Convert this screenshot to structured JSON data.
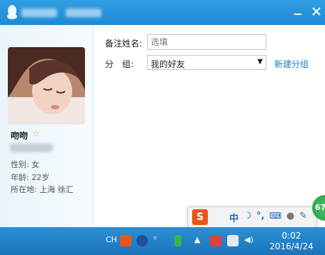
{
  "contact": {
    "nickname": "吻吻",
    "gender": "性别: 女",
    "age": "年龄: 22岁",
    "location": "所在地: 上海  徐汇"
  },
  "form": {
    "remark_label": "备注姓名:",
    "remark_placeholder": "选填",
    "group_label": "分　组:",
    "group_value": "我的好友",
    "new_group_link": "新建分组"
  },
  "ime": {
    "mode": "中",
    "brand_letter": "S"
  },
  "badge": "67",
  "taskbar": {
    "lang": "CH",
    "time": "0:02",
    "date": "2016/4/24"
  },
  "colors": {
    "titlebar": "#1f8ad4",
    "link": "#1a7fc6",
    "ime_brand": "#e8561b",
    "taskbar": "#1a74bb"
  }
}
